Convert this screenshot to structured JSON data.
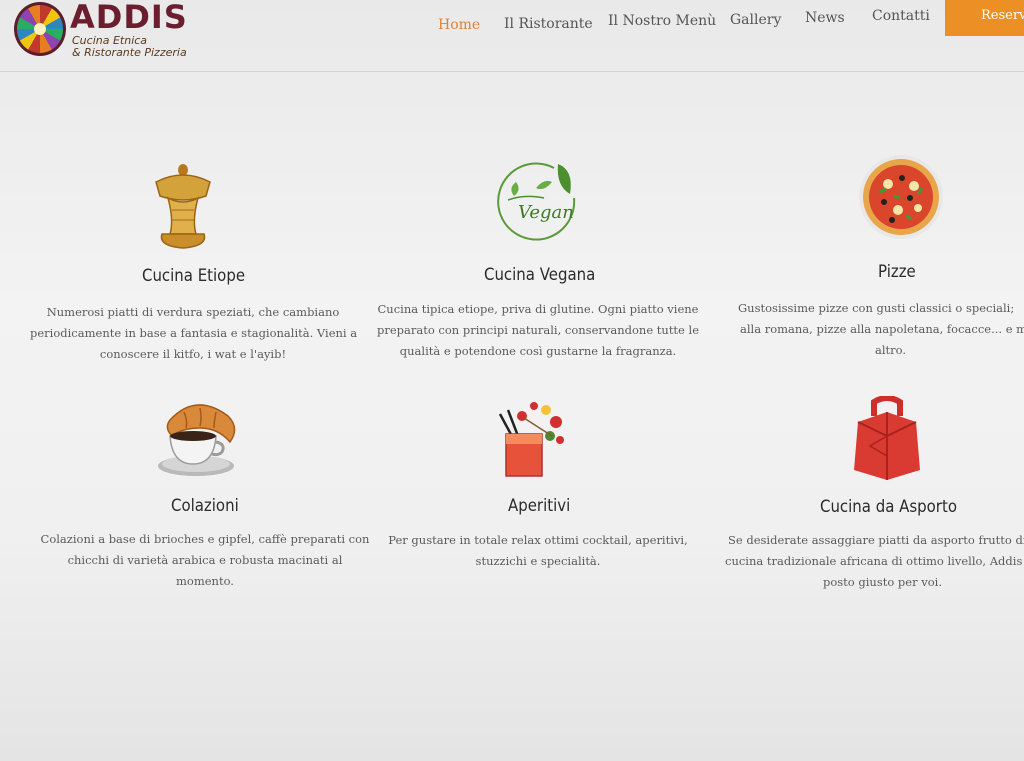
{
  "brand": {
    "name": "ADDIS",
    "tagline_1": "Cucina Etnica",
    "tagline_2": "& Ristorante Pizzeria"
  },
  "nav": {
    "home": "Home",
    "ristorante": "Il Ristorante",
    "menu": "Il Nostro Menù",
    "gallery": "Gallery",
    "news": "News",
    "contatti": "Contatti",
    "reserve": "Reserva",
    "active_color": "#d9833a",
    "reserve_color": "#ec8f24"
  },
  "cards": [
    {
      "icon": "etiopian-basket-icon",
      "title": "Cucina Etiope",
      "lines": [
        "Numerosi piatti di verdura speziati, che cambiano",
        "periodicamente in base a fantasia e stagionalità. Vieni a",
        "conoscere il kitfo, i wat e l'ayib!"
      ]
    },
    {
      "icon": "vegan-leaf-icon",
      "icon_text": "Vegan",
      "title": "Cucina Vegana",
      "lines": [
        "Cucina tipica etiope, priva di glutine. Ogni piatto viene",
        "preparato con principi naturali, conservandone tutte le",
        "qualità e potendone così gustarne la fragranza."
      ]
    },
    {
      "icon": "pizza-icon",
      "title": "Pizze",
      "lines": [
        "Gustosissime pizze con gusti classici o speciali;",
        "alla romana, pizze alla napoletana, focacce... e m",
        "altro."
      ]
    },
    {
      "icon": "croissant-coffee-icon",
      "title": "Colazioni",
      "lines": [
        "Colazioni a base di brioches e gipfel, caffè preparati con",
        "chicchi di varietà arabica e robusta macinati al",
        "momento."
      ]
    },
    {
      "icon": "cocktail-icon",
      "title": "Aperitivi",
      "lines": [
        "Per gustare in totale relax ottimi cocktail, aperitivi,",
        "stuzzichi e specialità."
      ]
    },
    {
      "icon": "takeaway-box-icon",
      "title": "Cucina da Asporto",
      "lines": [
        "Se desiderate assaggiare piatti da asporto frutto di u",
        "cucina tradizionale africana di ottimo livello, Addis",
        "posto giusto per voi."
      ]
    }
  ]
}
